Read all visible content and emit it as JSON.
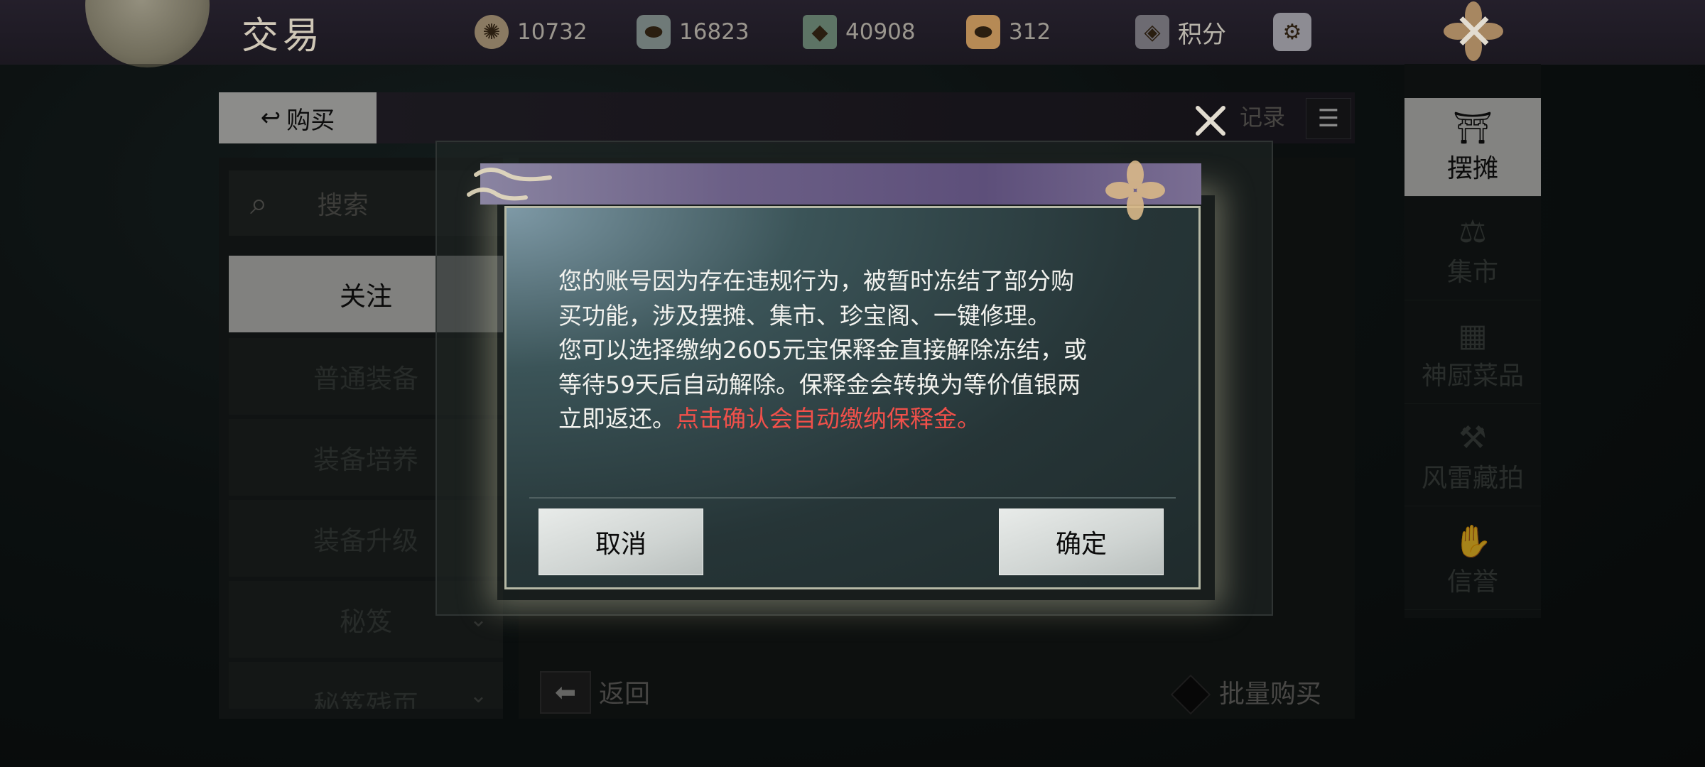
{
  "topbar": {
    "title": "交易",
    "currencies": [
      {
        "icon": "coin-wheel-icon",
        "value": "10732"
      },
      {
        "icon": "silver-ingot-icon",
        "value": "16823"
      },
      {
        "icon": "jade-token-icon",
        "value": "40908"
      },
      {
        "icon": "gold-ingot-icon",
        "value": "312"
      }
    ],
    "points_label": "积分",
    "settings_icon": "gear-seal-icon",
    "close_icon": "close-icon"
  },
  "panel": {
    "tab_buy_label": "购买",
    "records_label": "记录",
    "search_label": "搜索",
    "categories": [
      {
        "label": "关注"
      },
      {
        "label": "普通装备"
      },
      {
        "label": "装备培养"
      },
      {
        "label": "装备升级"
      },
      {
        "label": "秘笈"
      },
      {
        "label": "秘笈残页"
      }
    ],
    "back_label": "返回",
    "bulk_buy_label": "批量购买"
  },
  "right_nav": {
    "items": [
      {
        "label": "摆摊",
        "icon": "stall-icon"
      },
      {
        "label": "集市",
        "icon": "market-icon"
      },
      {
        "label": "神厨菜品",
        "icon": "kitchen-icon"
      },
      {
        "label": "风雷藏拍",
        "icon": "auction-hammer-icon"
      },
      {
        "label": "信誉",
        "icon": "reputation-icon"
      }
    ]
  },
  "dialog": {
    "line1": "您的账号因为存在违规行为，被暂时冻结了部分购",
    "line2": "买功能，涉及摆摊、集市、珍宝阁、一键修理。",
    "line3": "您可以选择缴纳2605元宝保释金直接解除冻结，或",
    "line4": "等待59天后自动解除。保释金会转换为等价值银两",
    "line5_prefix": "立即返还。",
    "line5_warning": "点击确认会自动缴纳保释金。",
    "cancel_label": "取消",
    "confirm_label": "确定"
  },
  "colors": {
    "warning_text": "#f0504a",
    "dialog_header": "#6b5f86"
  }
}
